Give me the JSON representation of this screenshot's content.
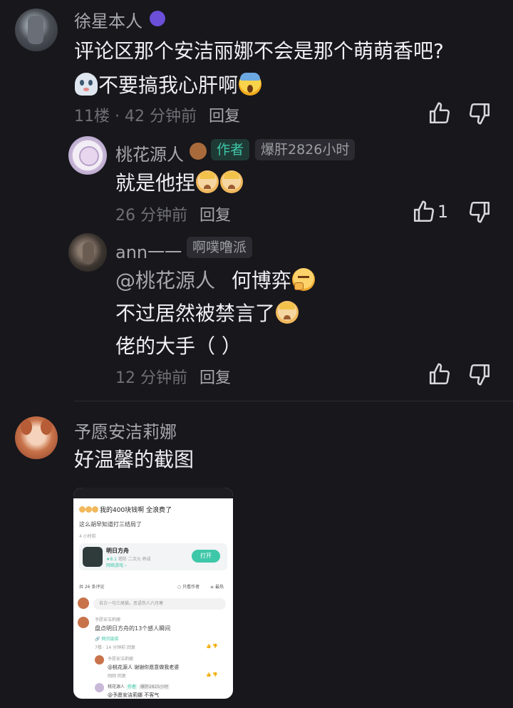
{
  "comments": [
    {
      "username": "徐星本人",
      "text_lines": [
        "评论区那个安洁丽娜不会是那个萌萌香吧?",
        "不要搞我心肝啊"
      ],
      "floor": "11楼",
      "sep": "·",
      "time": "42 分钟前",
      "reply_label": "回复",
      "replies": [
        {
          "username": "桃花源人",
          "badge_author": "作者",
          "badge_extra": "爆肝2826小时",
          "text": "就是他捏",
          "time": "26 分钟前",
          "reply_label": "回复",
          "like_count": "1"
        },
        {
          "username": "ann一一",
          "badge_extra": "啊噗噜派",
          "mention": "@桃花源人",
          "text_line1": "何博弈",
          "text_line2": "不过居然被禁言了",
          "text_line3": "佬的大手（ ）",
          "time": "12 分钟前",
          "reply_label": "回复"
        }
      ]
    },
    {
      "username": "予愿安洁莉娜",
      "text": "好温馨的截图",
      "screenshot": {
        "post_title": "我的400块钱啊 全浪费了",
        "post_sub": "这么胡早知道打三结局了",
        "post_time": "4 小时前",
        "app_name": "明日方舟",
        "app_rating": "★8.1",
        "app_tags": "塔防  二次元  养成",
        "app_link": "网络游戏 ›",
        "app_button": "打开",
        "comments_count": "共 26 条评论",
        "only_author": "只看作者",
        "sort": "最热",
        "input_placeholder": "自古一句三尾猫，恶语伤人六月寒",
        "c1_user": "予愿安洁莉娜",
        "c1_text": "盘点明日方舟的13个感人瞬间",
        "c1_link": "网页链接",
        "c1_meta": "7楼 · 14 分钟前  回复",
        "c2_user": "予愿安洁莉娜",
        "c2_text": "@桃花源人  谢谢你愿意做我老婆",
        "c2_meta": "刚刚  回复",
        "c3_user": "桃花源人",
        "c3_badge": "作者",
        "c3_badge2": "爆肝2825小时",
        "c3_text": "@予愿安洁莉娜  不客气"
      }
    }
  ],
  "icons": {
    "like": "thumbs-up-icon",
    "dislike": "thumbs-down-icon"
  },
  "colors": {
    "background": "#17171c",
    "author_badge": "#3ec7a8",
    "app_button": "#3ec7a8"
  }
}
